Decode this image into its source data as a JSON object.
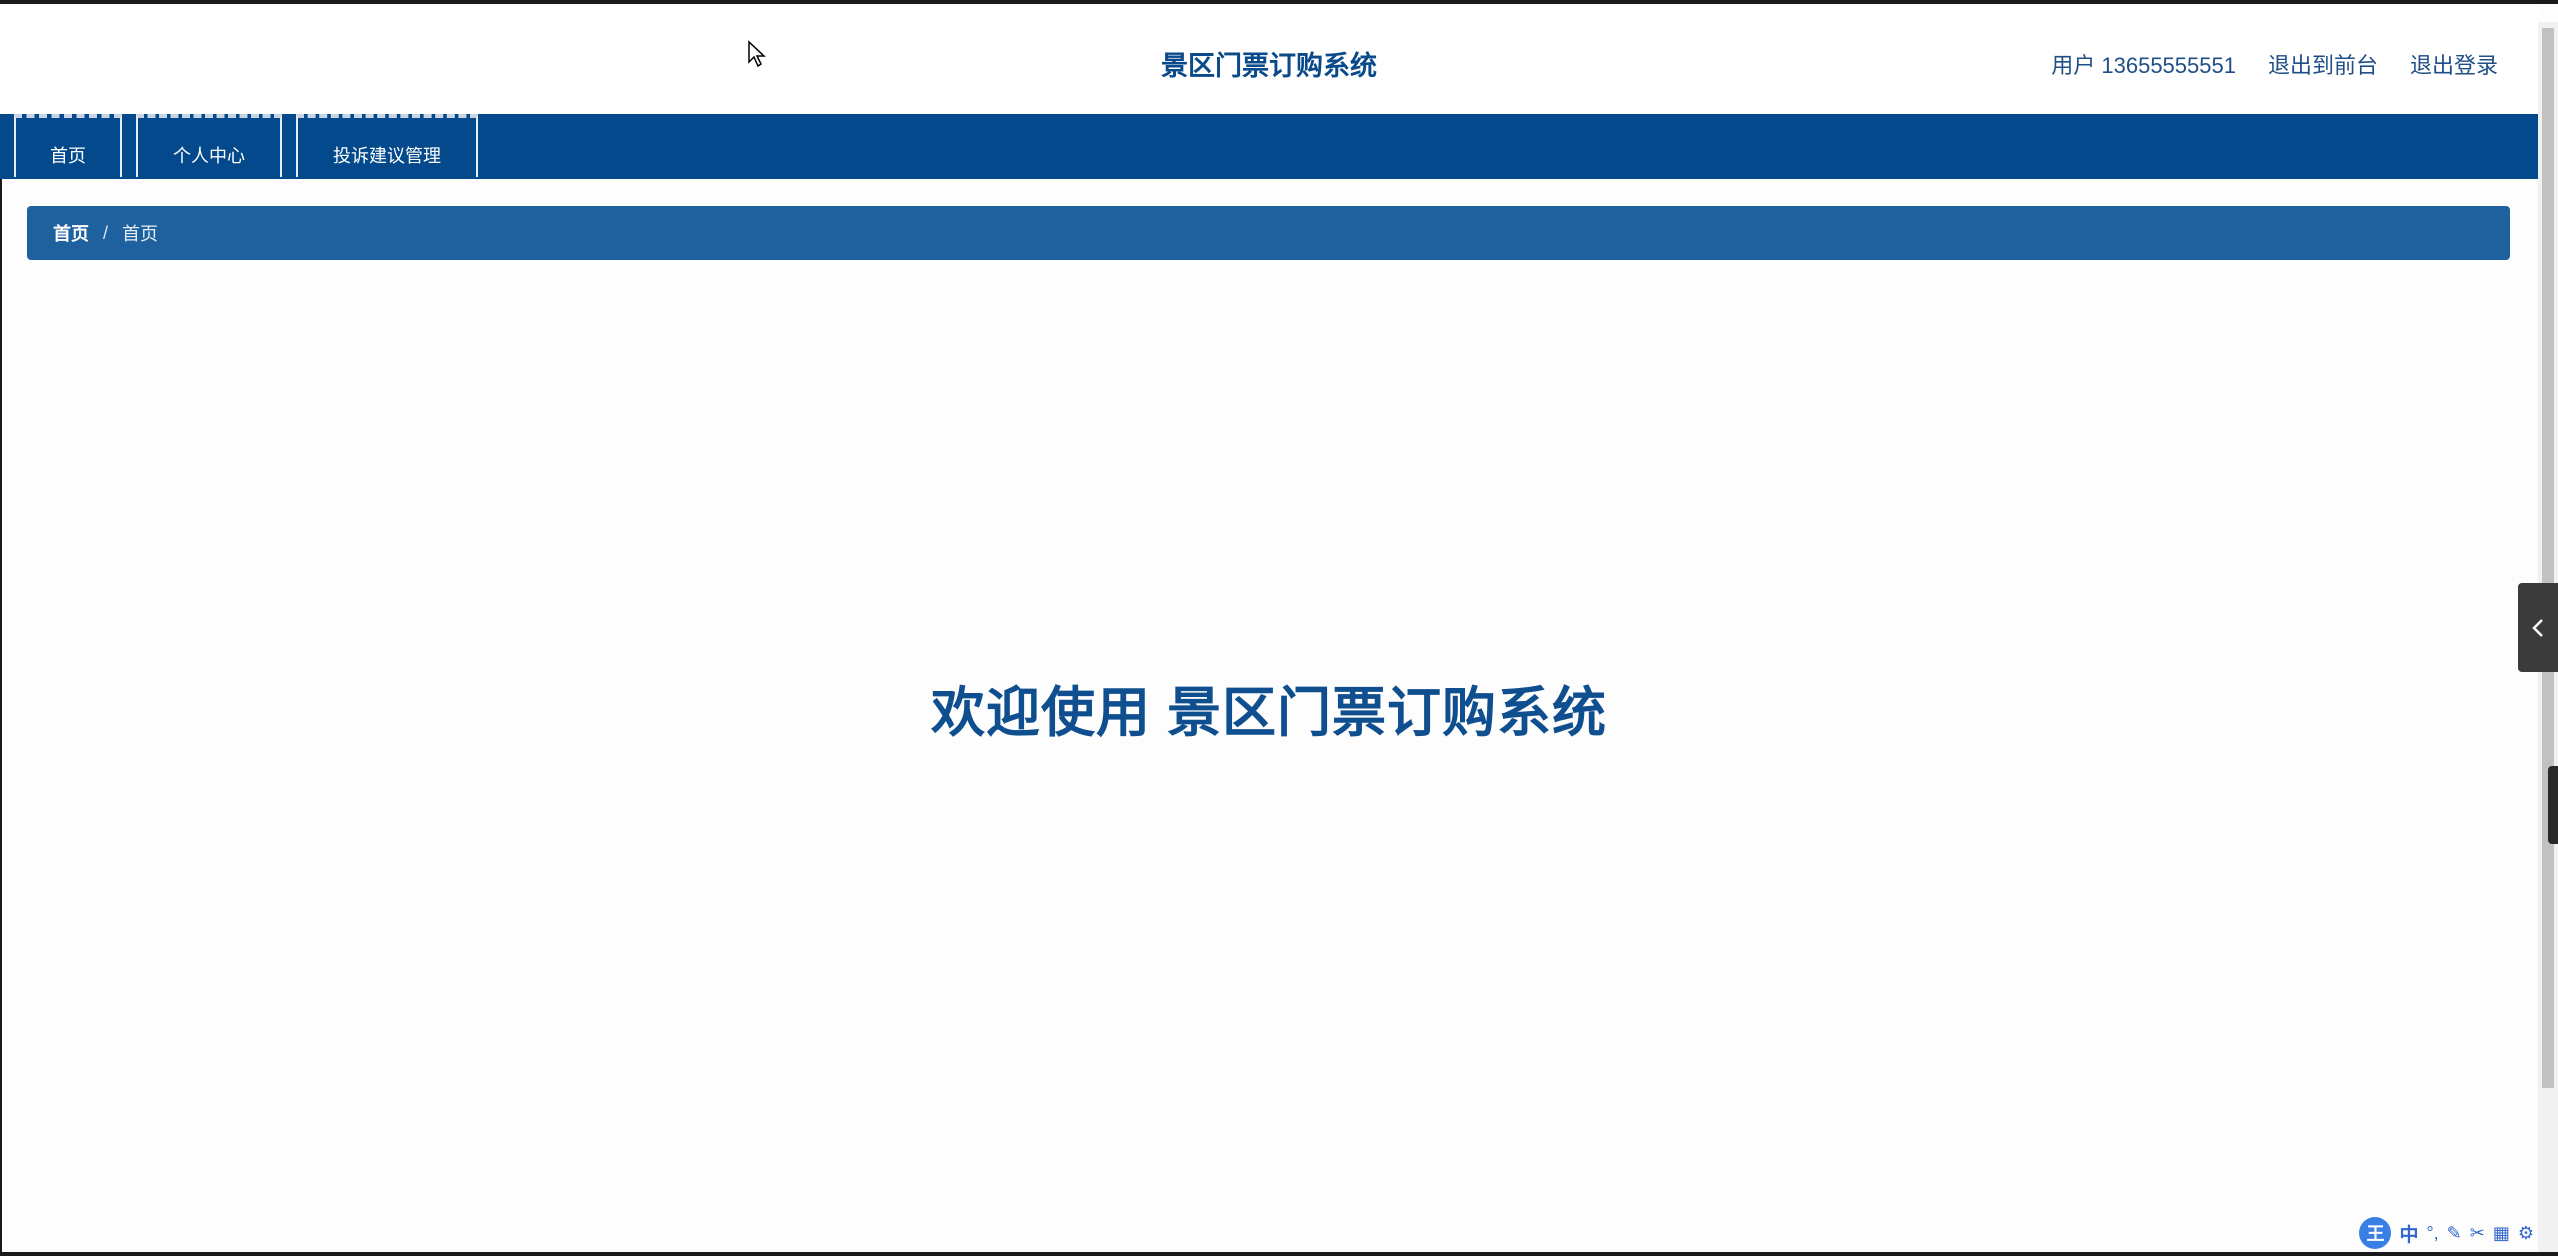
{
  "header": {
    "title": "景区门票订购系统",
    "user_label": "用户 13655555551",
    "back_to_front": "退出到前台",
    "logout": "退出登录"
  },
  "nav": {
    "tabs": [
      "首页",
      "个人中心",
      "投诉建议管理"
    ]
  },
  "breadcrumb": {
    "root": "首页",
    "separator": "/",
    "current": "首页"
  },
  "main": {
    "welcome": "欢迎使用 景区门票订购系统"
  },
  "side_handle": {
    "icon": "chevron-left-icon"
  },
  "ime_toolbar": {
    "badge": "王",
    "lang": "中",
    "items": [
      "°,",
      "✎",
      "✂",
      "▦",
      "⚙"
    ]
  },
  "colors": {
    "nav_bg": "#03498b",
    "breadcrumb_bg": "#1f609e",
    "title_color": "#0a4a8a",
    "welcome_color": "#0f4f8f"
  }
}
